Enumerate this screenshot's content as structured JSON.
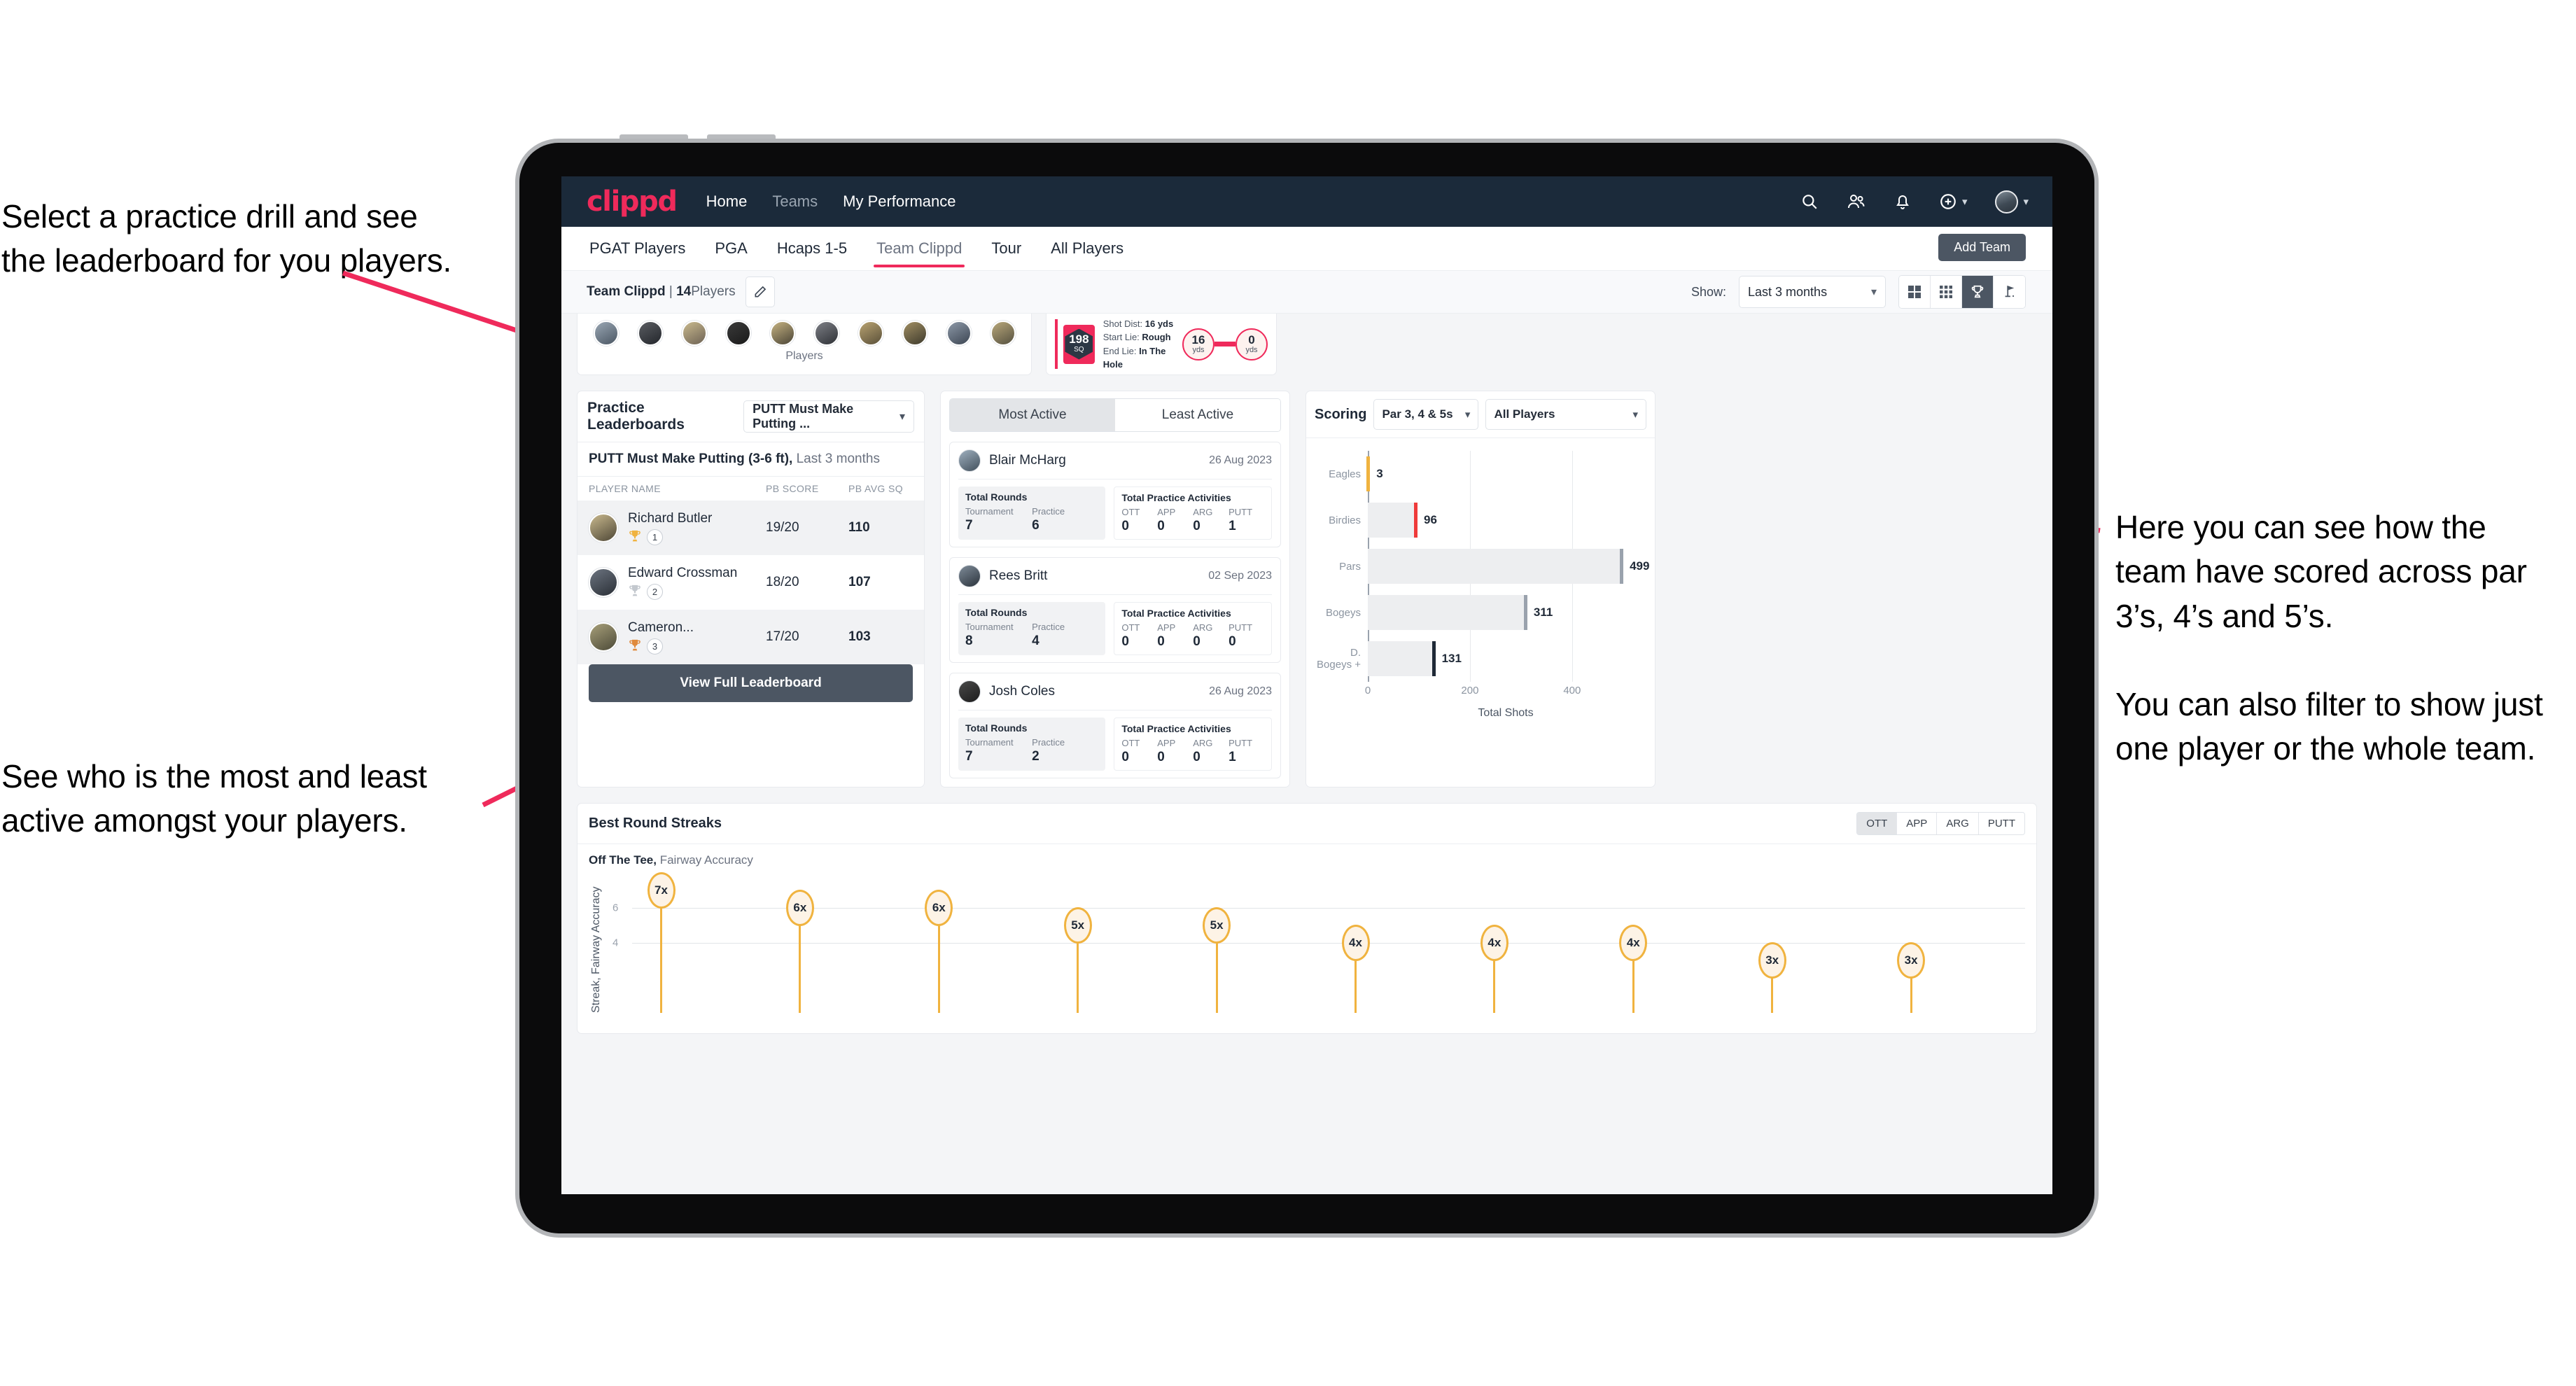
{
  "annotations": {
    "top_left": [
      "Select a practice drill and see",
      "the leaderboard for you players."
    ],
    "bottom_left": [
      "See who is the most and least",
      "active amongst your players."
    ],
    "right": [
      "Here you can see how the team have scored across par 3’s, 4’s and 5’s.",
      "You can also filter to show just one player or the whole team."
    ],
    "arrow_color": "#ef2a5b"
  },
  "navbar": {
    "logo": "clippd",
    "links": [
      {
        "label": "Home",
        "dim": false
      },
      {
        "label": "Teams",
        "dim": true
      },
      {
        "label": "My Performance",
        "dim": false
      }
    ],
    "icons": [
      "search-icon",
      "people-icon",
      "bell-icon",
      "plus-circle-icon",
      "avatar"
    ],
    "background": "#1b2a3a",
    "accent": "#ef2a5b"
  },
  "tabbar": {
    "tabs": [
      {
        "label": "PGAT Players",
        "active": false
      },
      {
        "label": "PGA",
        "active": false
      },
      {
        "label": "Hcaps 1-5",
        "active": false
      },
      {
        "label": "Team Clippd",
        "active": true
      },
      {
        "label": "Tour",
        "active": false
      },
      {
        "label": "All Players",
        "active": false
      }
    ],
    "add_team_label": "Add Team"
  },
  "subheader": {
    "team_name": "Team Clippd",
    "team_count": "14",
    "players_word": "Players",
    "edit_icon": "pencil-icon",
    "show_label": "Show:",
    "range_value": "Last 3 months",
    "view_toggles": [
      {
        "name": "grid-2x2-icon",
        "active": false
      },
      {
        "name": "grid-3x3-icon",
        "active": false
      },
      {
        "name": "trophy-icon",
        "active": true
      },
      {
        "name": "golf-flag-icon",
        "active": false
      }
    ]
  },
  "players_strip": {
    "caption": "Players",
    "avatar_count": 10
  },
  "shot_card": {
    "sq_value": "198",
    "sq_unit": "SQ",
    "lines": [
      {
        "label": "Shot Dist:",
        "value": "16 yds"
      },
      {
        "label": "Start Lie:",
        "value": "Rough"
      },
      {
        "label": "End Lie:",
        "value": "In The Hole"
      }
    ],
    "start_yds": "16",
    "end_yds": "0",
    "unit": "yds"
  },
  "leaderboard": {
    "title": "Practice Leaderboards",
    "drill_select": "PUTT Must Make Putting ...",
    "subtitle_bold": "PUTT Must Make Putting (3-6 ft),",
    "subtitle_muted": "Last 3 months",
    "columns": [
      "PLAYER NAME",
      "PB SCORE",
      "PB AVG SQ"
    ],
    "rows": [
      {
        "name": "Richard Butler",
        "score": "19/20",
        "sq": "110",
        "rank": "1",
        "trophy": "gold"
      },
      {
        "name": "Edward Crossman",
        "score": "18/20",
        "sq": "107",
        "rank": "2",
        "trophy": "silver"
      },
      {
        "name": "Cameron...",
        "score": "17/20",
        "sq": "103",
        "rank": "3",
        "trophy": "bronze"
      }
    ],
    "button_label": "View Full Leaderboard"
  },
  "activity": {
    "tabs": [
      {
        "label": "Most Active",
        "active": true
      },
      {
        "label": "Least Active",
        "active": false
      }
    ],
    "rounds_label": "Total Rounds",
    "activities_label": "Total Practice Activities",
    "rounds_keys": [
      "Tournament",
      "Practice"
    ],
    "activity_keys": [
      "OTT",
      "APP",
      "ARG",
      "PUTT"
    ],
    "players": [
      {
        "name": "Blair McHarg",
        "date": "26 Aug 2023",
        "tournament": "7",
        "practice": "6",
        "ott": "0",
        "app": "0",
        "arg": "0",
        "putt": "1"
      },
      {
        "name": "Rees Britt",
        "date": "02 Sep 2023",
        "tournament": "8",
        "practice": "4",
        "ott": "0",
        "app": "0",
        "arg": "0",
        "putt": "0"
      },
      {
        "name": "Josh Coles",
        "date": "26 Aug 2023",
        "tournament": "7",
        "practice": "2",
        "ott": "0",
        "app": "0",
        "arg": "0",
        "putt": "1"
      }
    ]
  },
  "scoring": {
    "title": "Scoring",
    "par_filter": "Par 3, 4 & 5s",
    "player_filter": "All Players"
  },
  "streaks": {
    "title": "Best Round Streaks",
    "toggle": [
      {
        "label": "OTT",
        "active": true
      },
      {
        "label": "APP",
        "active": false
      },
      {
        "label": "ARG",
        "active": false
      },
      {
        "label": "PUTT",
        "active": false
      }
    ],
    "sub_bold": "Off The Tee,",
    "sub_muted": "Fairway Accuracy"
  },
  "chart_data": [
    {
      "type": "bar",
      "orientation": "horizontal",
      "title": "Scoring",
      "categories": [
        "Eagles",
        "Birdies",
        "Pars",
        "Bogeys",
        "D. Bogeys +"
      ],
      "values": [
        3,
        96,
        499,
        311,
        131
      ],
      "cap_colors": [
        "#f0b33f",
        "#ef3a3a",
        "#9aa2ad",
        "#9aa2ad",
        "#1f2937"
      ],
      "xlabel": "Total Shots",
      "ylabel": "",
      "xticks": [
        0,
        200,
        400
      ],
      "xlim": [
        0,
        540
      ],
      "grid": true,
      "legend": false
    },
    {
      "type": "bar",
      "orientation": "vertical",
      "title": "Best Round Streaks",
      "subtitle": "Off The Tee, Fairway Accuracy",
      "categories": [
        "1",
        "2",
        "3",
        "4",
        "5",
        "6",
        "7",
        "8",
        "9",
        "10"
      ],
      "values": [
        7,
        6,
        6,
        5,
        5,
        4,
        4,
        4,
        3,
        3
      ],
      "value_labels": [
        "7x",
        "6x",
        "6x",
        "5x",
        "5x",
        "4x",
        "4x",
        "4x",
        "3x",
        "3x"
      ],
      "ylabel": "Streak, Fairway Accuracy",
      "yticks": [
        4,
        6
      ],
      "ylim": [
        0,
        8
      ],
      "marker_color": "#f0b33f",
      "grid": true,
      "legend": false
    }
  ]
}
